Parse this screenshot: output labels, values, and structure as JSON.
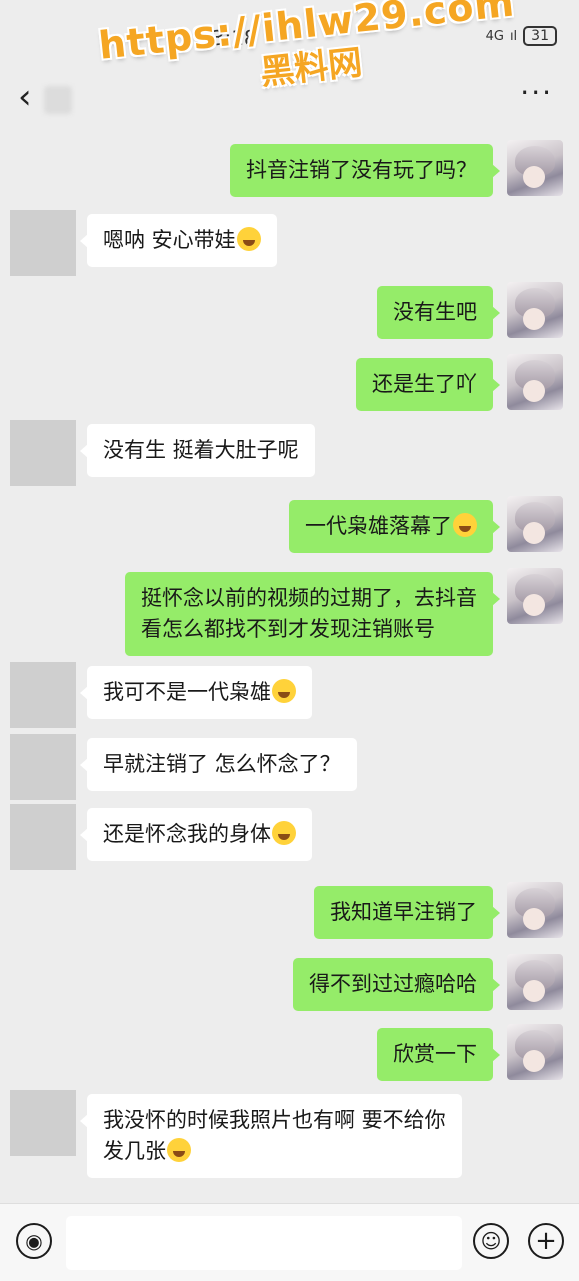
{
  "status_bar": {
    "time": "13:18",
    "network": "4G",
    "signal": "ıl",
    "battery": "31"
  },
  "watermark": {
    "url": "https://ihlw29.com",
    "name": "黑料网"
  },
  "nav": {
    "back_icon": "chevron-left-icon",
    "more_icon": "more-dots-icon"
  },
  "messages": [
    {
      "side": "right",
      "text": "抖音注销了没有玩了吗？"
    },
    {
      "side": "left",
      "text": "嗯呐 安心带娃",
      "emoji": true
    },
    {
      "side": "right",
      "text": "没有生吧"
    },
    {
      "side": "right",
      "text": "还是生了吖"
    },
    {
      "side": "left",
      "text": "没有生 挺着大肚子呢"
    },
    {
      "side": "right",
      "text": "一代枭雄落幕了",
      "emoji": true
    },
    {
      "side": "right",
      "text": "挺怀念以前的视频的过期了，去抖音\n看怎么都找不到才发现注销账号"
    },
    {
      "side": "left",
      "text": "我可不是一代枭雄",
      "emoji": true
    },
    {
      "side": "left",
      "text": "早就注销了 怎么怀念了？"
    },
    {
      "side": "left",
      "text": "还是怀念我的身体",
      "emoji": true
    },
    {
      "side": "right",
      "text": "我知道早注销了"
    },
    {
      "side": "right",
      "text": "得不到过过瘾哈哈"
    },
    {
      "side": "right",
      "text": "欣赏一下"
    },
    {
      "side": "left",
      "text": "我没怀的时候我照片也有啊 要不给你\n发几张",
      "emoji": true
    }
  ],
  "input_bar": {
    "placeholder": ""
  }
}
